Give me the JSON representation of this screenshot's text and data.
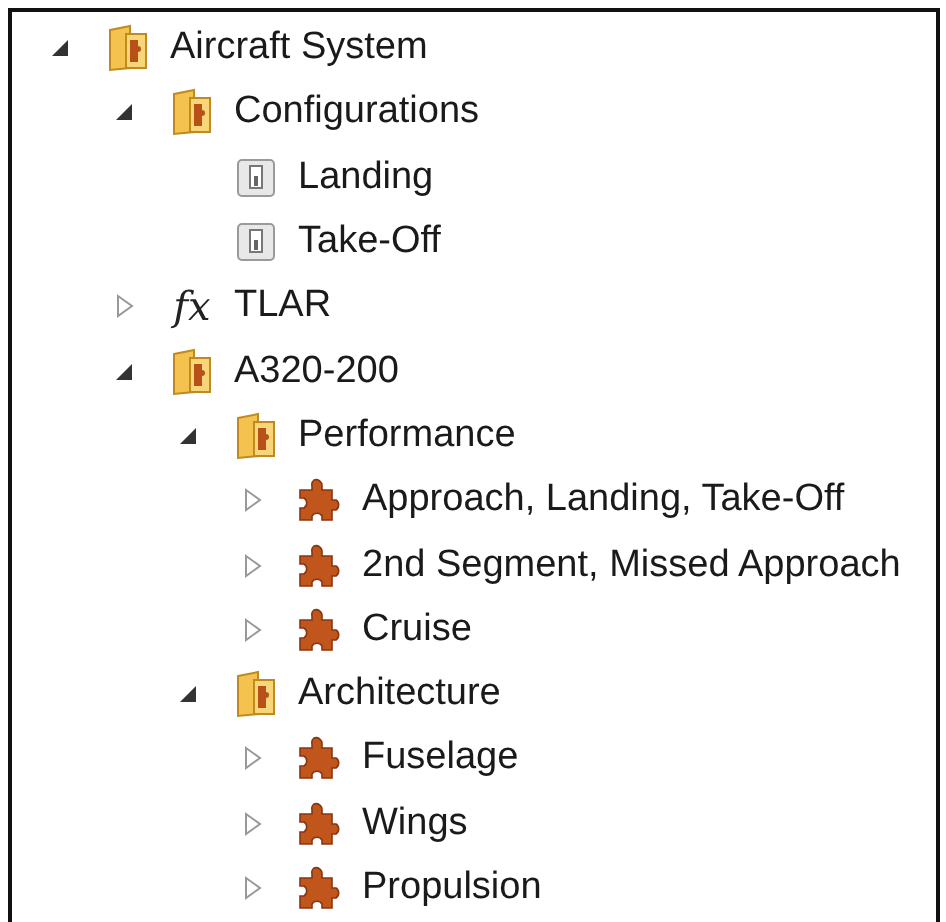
{
  "tree": [
    {
      "label": "Aircraft System",
      "kind": "folder",
      "has_children": true,
      "expanded": true,
      "children": [
        {
          "label": "Configurations",
          "kind": "folder",
          "has_children": true,
          "expanded": true,
          "children": [
            {
              "label": "Landing",
              "kind": "switch",
              "has_children": false
            },
            {
              "label": "Take-Off",
              "kind": "switch",
              "has_children": false
            }
          ]
        },
        {
          "label": "TLAR",
          "kind": "function",
          "symbol": "fx",
          "has_children": true,
          "expanded": false
        },
        {
          "label": "A320-200",
          "kind": "folder",
          "has_children": true,
          "expanded": true,
          "children": [
            {
              "label": "Performance",
              "kind": "folder",
              "has_children": true,
              "expanded": true,
              "children": [
                {
                  "label": "Approach, Landing, Take-Off",
                  "kind": "module",
                  "has_children": true,
                  "expanded": false
                },
                {
                  "label": "2nd Segment, Missed Approach",
                  "kind": "module",
                  "has_children": true,
                  "expanded": false
                },
                {
                  "label": "Cruise",
                  "kind": "module",
                  "has_children": true,
                  "expanded": false
                }
              ]
            },
            {
              "label": "Architecture",
              "kind": "folder",
              "has_children": true,
              "expanded": true,
              "children": [
                {
                  "label": "Fuselage",
                  "kind": "module",
                  "has_children": true,
                  "expanded": false
                },
                {
                  "label": "Wings",
                  "kind": "module",
                  "has_children": true,
                  "expanded": false
                },
                {
                  "label": "Propulsion",
                  "kind": "module",
                  "has_children": true,
                  "expanded": false
                }
              ]
            }
          ]
        }
      ]
    }
  ]
}
